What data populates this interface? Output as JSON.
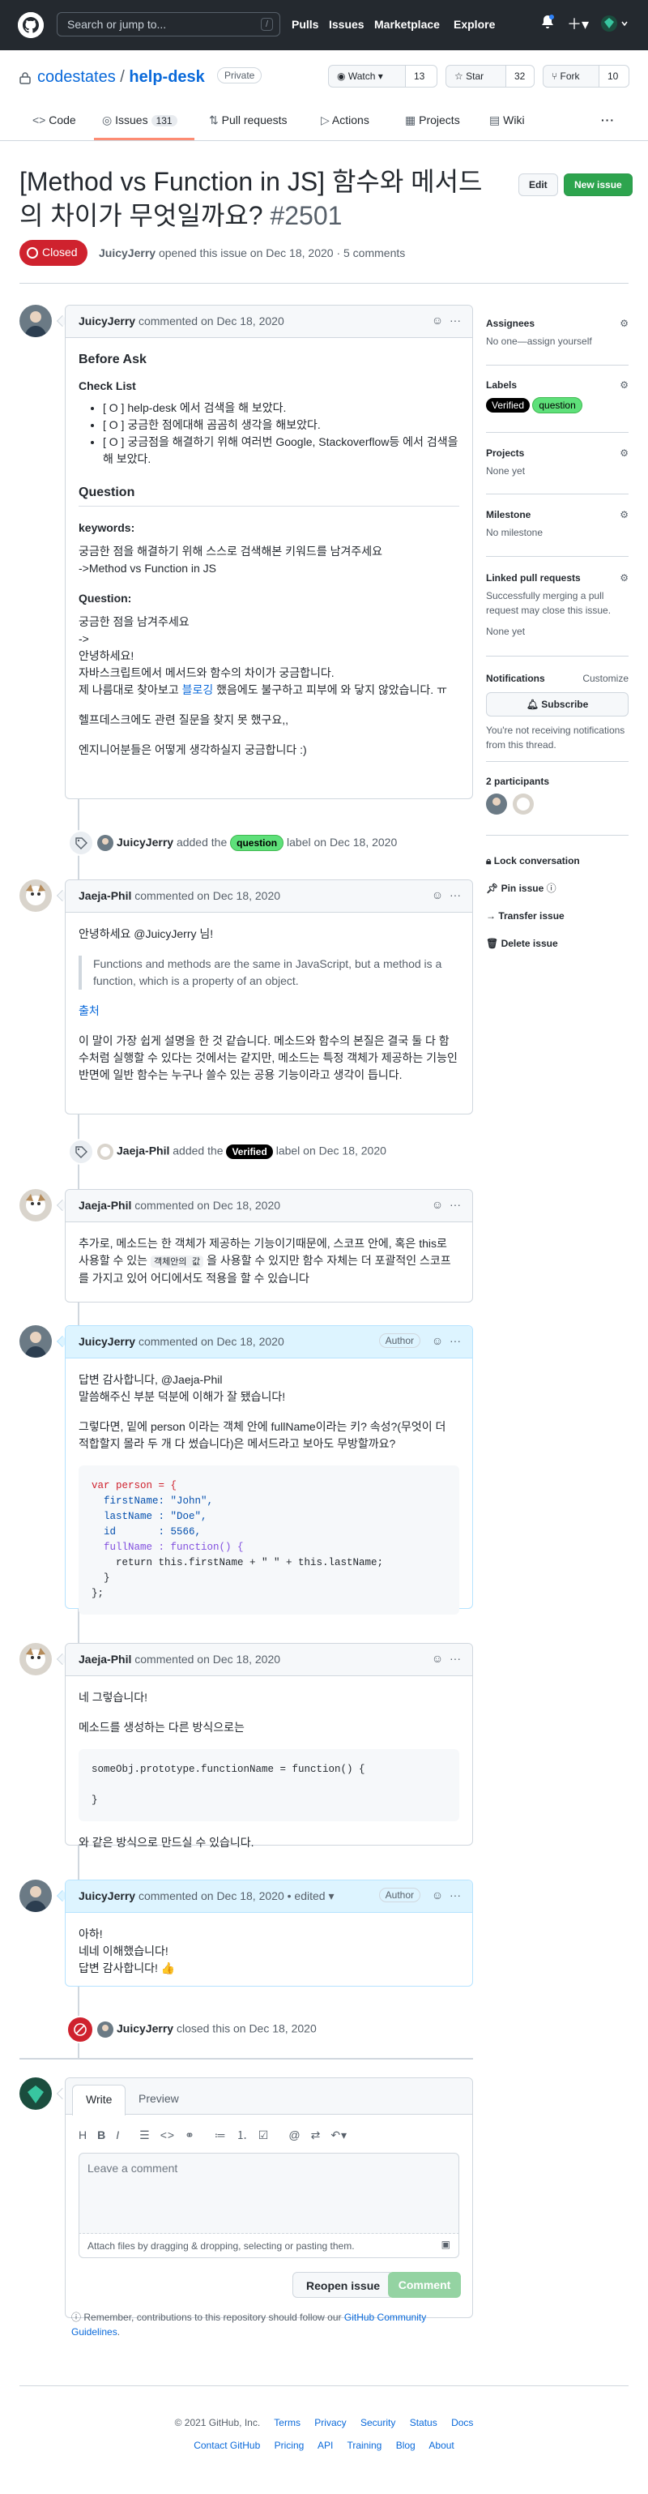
{
  "header": {
    "search_placeholder": "Search or jump to...",
    "slash_key": "/",
    "nav": [
      "Pulls",
      "Issues",
      "Marketplace",
      "Explore"
    ]
  },
  "repo": {
    "owner": "codestates",
    "separator": "/",
    "name": "help-desk",
    "visibility": "Private",
    "watch_label": "Watch",
    "watch_count": "13",
    "star_label": "Star",
    "star_count": "32",
    "fork_label": "Fork",
    "fork_count": "10",
    "tabs": [
      {
        "label": "Code"
      },
      {
        "label": "Issues",
        "count": "131"
      },
      {
        "label": "Pull requests"
      },
      {
        "label": "Actions"
      },
      {
        "label": "Projects"
      },
      {
        "label": "Wiki"
      }
    ],
    "more": "···"
  },
  "issue": {
    "title": "[Method vs Function in JS] 함수와 메서드의 차이가 무엇일까요?",
    "number": "#2501",
    "edit_label": "Edit",
    "new_issue_label": "New issue",
    "state": "Closed",
    "author": "JuicyJerry",
    "meta": "opened this issue on Dec 18, 2020 · 5 comments"
  },
  "comments": [
    {
      "author": "JuicyJerry",
      "header": "commented on Dec 18, 2020",
      "before_ask": "Before Ask",
      "checklist_title": "Check List",
      "checklist": [
        "[ O ] help-desk 에서 검색을 해 보았다.",
        "[ O ] 궁금한 점에대해 곰곰히 생각을 해보았다.",
        "[ O ] 궁금점을 해결하기 위해 여러번 Google, Stackoverflow등 에서 검색을 해 보았다."
      ],
      "question_heading": "Question",
      "keywords_label": "keywords:",
      "keywords_text1": "궁금한 점을 해결하기 위해 스스로 검색해본 키워드를 남겨주세요",
      "keywords_text2": "->Method vs Function in JS",
      "question_label": "Question:",
      "question_lines": [
        "궁금한 점을 남겨주세요",
        "->",
        "안녕하세요!",
        "자바스크립트에서 메서드와 함수의 차이가 궁금합니다.",
        "제 나름대로 찾아보고 블로깅 했음에도 불구하고 피부에 와 닿지 않았습니다. ㅠ"
      ],
      "blog_word": "블로깅",
      "q_extra1": "헬프데스크에도 관련 질문을 찾지 못 했구요,,",
      "q_extra2": "엔지니어분들은 어떻게 생각하실지 궁금합니다 :)"
    },
    {
      "author": "Jaeja-Phil",
      "header": "commented on Dec 18, 2020",
      "greeting": "안녕하세요 @JuicyJerry 님!",
      "quote": "Functions and methods are the same in JavaScript, but a method is a function, which is a property of an object.",
      "source": "출처",
      "body": "이 말이 가장 쉽게 설명을 한 것 같습니다. 메소드와 함수의 본질은 결국 둘 다 함수처럼 실행할 수 있다는 것에서는 같지만, 메소드는 특정 객체가 제공하는 기능인 반면에 일반 함수는 누구나 쓸수 있는 공용 기능이라고 생각이 듭니다."
    },
    {
      "author": "Jaeja-Phil",
      "header": "commented on Dec 18, 2020",
      "body_a": "추가로, 메소드는 한 객체가 제공하는 기능이기때문에, 스코프 안에, 혹은 this로 사용할 수 있는",
      "body_code": "객체안의 값",
      "body_b": "을 사용할 수 있지만 함수 자체는 더 포괄적인 스코프를 가지고 있어 어디에서도 적용을 할 수 있습니다"
    },
    {
      "author": "JuicyJerry",
      "header": "commented on Dec 18, 2020",
      "badge": "Author",
      "line1": "답변 감사합니다, @Jaeja-Phil",
      "line2": "말씀해주신 부분 덕분에 이해가 잘 됐습니다!",
      "line3": "그렇다면, 밑에 person 이라는 객체 안에 fullName이라는 키? 속성?(무엇이 더 적합할지 몰라 두 개 다 썼습니다)은 메서드라고 보아도 무방할까요?",
      "code": [
        "var person = {",
        "  firstName: \"John\",",
        "  lastName : \"Doe\",",
        "  id       : 5566,",
        "  fullName : function() {",
        "    return this.firstName + \" \" + this.lastName;",
        "  }",
        "};"
      ]
    },
    {
      "author": "Jaeja-Phil",
      "header": "commented on Dec 18, 2020",
      "line1": "네 그렇습니다!",
      "line2": "메소드를 생성하는 다른 방식으로는",
      "code": [
        "someObj.prototype.functionName = function() {",
        "",
        "}"
      ],
      "line3": "와 같은 방식으로 만드실 수 있습니다."
    },
    {
      "author": "JuicyJerry",
      "header": "commented on Dec 18, 2020 • edited ▾",
      "badge": "Author",
      "lines": [
        "아하!",
        "네네 이해했습니다!",
        "답변 감사합니다! 👍"
      ]
    }
  ],
  "events": [
    {
      "actor": "JuicyJerry",
      "text1": "added the",
      "label": "question",
      "text2": "label on Dec 18, 2020"
    },
    {
      "actor": "Jaeja-Phil",
      "text1": "added the",
      "label": "Verified",
      "text2": "label on Dec 18, 2020"
    },
    {
      "actor": "JuicyJerry",
      "text": "closed this on Dec 18, 2020"
    }
  ],
  "composer": {
    "write_tab": "Write",
    "preview_tab": "Preview",
    "placeholder": "Leave a comment",
    "attach": "Attach files by dragging & dropping, selecting or pasting them.",
    "reopen": "Reopen issue",
    "comment": "Comment",
    "remember": "Remember, contributions to this repository should follow our",
    "guidelines": "GitHub Community Guidelines",
    "period": "."
  },
  "sidebar": {
    "assignees_title": "Assignees",
    "assignees_value": "No one—assign yourself",
    "labels_title": "Labels",
    "labels": [
      {
        "name": "Verified",
        "color": "#000000",
        "text": "#ffffff"
      },
      {
        "name": "question",
        "color": "#5ee07a",
        "text": "#000000"
      }
    ],
    "projects_title": "Projects",
    "projects_value": "None yet",
    "milestone_title": "Milestone",
    "milestone_value": "No milestone",
    "linked_title": "Linked pull requests",
    "linked_desc": "Successfully merging a pull request may close this issue.",
    "linked_value": "None yet",
    "notifications_title": "Notifications",
    "customize": "Customize",
    "subscribe": "Subscribe",
    "notif_desc": "You're not receiving notifications from this thread.",
    "participants_title": "2 participants",
    "lock": "Lock conversation",
    "pin": "Pin issue",
    "transfer": "Transfer issue",
    "delete": "Delete issue"
  },
  "footer": {
    "copyright": "© 2021 GitHub, Inc.",
    "row1": [
      "Terms",
      "Privacy",
      "Security",
      "Status",
      "Docs"
    ],
    "row2": [
      "Contact GitHub",
      "Pricing",
      "API",
      "Training",
      "Blog",
      "About"
    ]
  },
  "colors": {
    "header_bg": "#24292f",
    "closed_red": "#cf222e",
    "link_blue": "#0969da",
    "green_button": "#2da44e"
  }
}
